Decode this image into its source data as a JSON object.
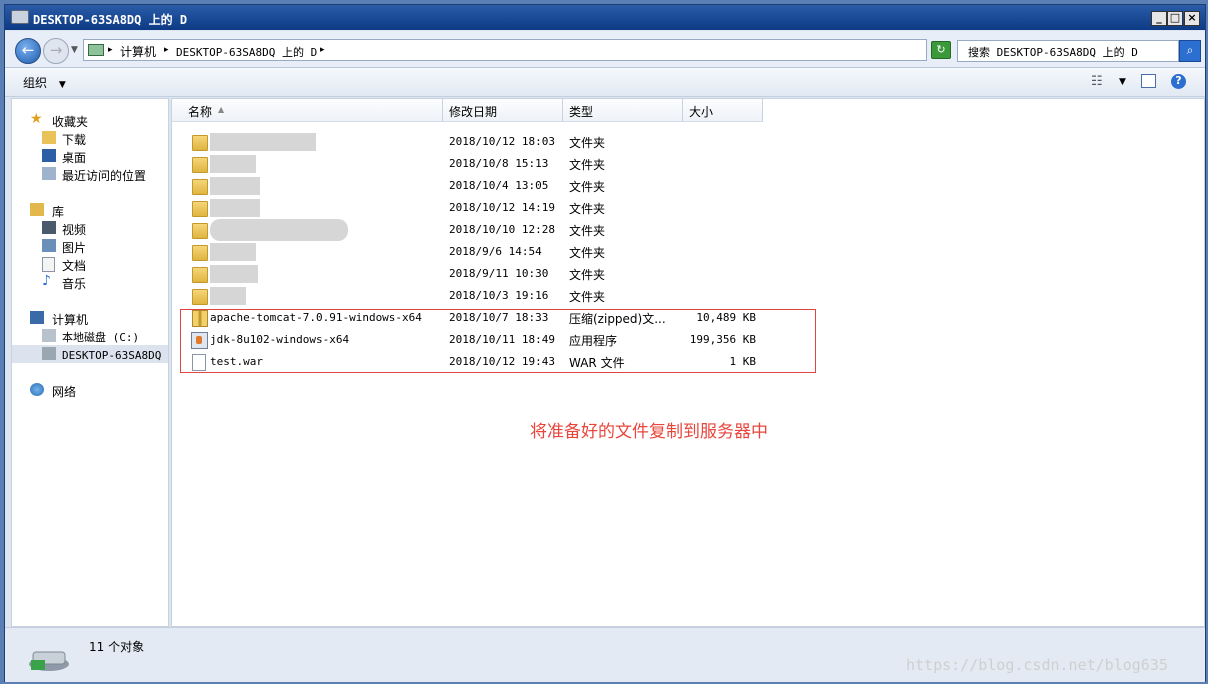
{
  "window": {
    "title": "DESKTOP-63SA8DQ 上的 D"
  },
  "address": {
    "crumbs": [
      "计算机",
      "DESKTOP-63SA8DQ 上的 D"
    ]
  },
  "search": {
    "placeholder": "搜索 DESKTOP-63SA8DQ 上的 D"
  },
  "toolbar": {
    "organize_label": "组织"
  },
  "sidebar": {
    "favorites": {
      "label": "收藏夹",
      "items": [
        "下载",
        "桌面",
        "最近访问的位置"
      ]
    },
    "libraries": {
      "label": "库",
      "items": [
        "视频",
        "图片",
        "文档",
        "音乐"
      ]
    },
    "computer": {
      "label": "计算机",
      "items": [
        "本地磁盘 (C:)",
        "DESKTOP-63SA8DQ 上"
      ]
    },
    "network": {
      "label": "网络"
    }
  },
  "columns": {
    "name": "名称",
    "date": "修改日期",
    "type": "类型",
    "size": "大小"
  },
  "folders": [
    {
      "date": "2018/10/12 18:03",
      "type": "文件夹"
    },
    {
      "date": "2018/10/8 15:13",
      "type": "文件夹"
    },
    {
      "date": "2018/10/4 13:05",
      "type": "文件夹"
    },
    {
      "date": "2018/10/12 14:19",
      "type": "文件夹"
    },
    {
      "date": "2018/10/10 12:28",
      "type": "文件夹"
    },
    {
      "date": "2018/9/6 14:54",
      "type": "文件夹"
    },
    {
      "date": "2018/9/11 10:30",
      "type": "文件夹"
    },
    {
      "date": "2018/10/3 19:16",
      "type": "文件夹"
    }
  ],
  "files": [
    {
      "name": "apache-tomcat-7.0.91-windows-x64",
      "date": "2018/10/7 18:33",
      "type": "压缩(zipped)文...",
      "size": "10,489 KB",
      "icon": "zip-icon"
    },
    {
      "name": "jdk-8u102-windows-x64",
      "date": "2018/10/11 18:49",
      "type": "应用程序",
      "size": "199,356 KB",
      "icon": "installer-icon"
    },
    {
      "name": "test.war",
      "date": "2018/10/12 19:43",
      "type": "WAR 文件",
      "size": "1 KB",
      "icon": "file-icon"
    }
  ],
  "annotation": "将准备好的文件复制到服务器中",
  "status": {
    "count": "11 个对象"
  },
  "watermark": "https://blog.csdn.net/blog635"
}
